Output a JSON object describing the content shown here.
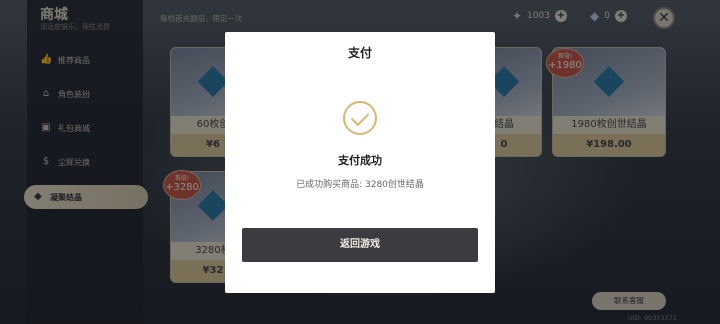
{
  "shop": {
    "title": "商城",
    "subtitle": "请适度娱乐，理性消费"
  },
  "header": {
    "hint": "每档首充翻倍，限定一次",
    "currencies": [
      {
        "icon": "star-crystal-icon",
        "value": "1003"
      },
      {
        "icon": "genesis-crystal-icon",
        "value": "0"
      }
    ]
  },
  "sidebar": {
    "items": [
      {
        "label": "推荐商品",
        "icon": "thumbs-up-icon"
      },
      {
        "label": "角色装扮",
        "icon": "hanger-icon"
      },
      {
        "label": "礼包商城",
        "icon": "gift-icon"
      },
      {
        "label": "尘辉兑换",
        "icon": "money-bag-icon"
      },
      {
        "label": "凝聚结晶",
        "icon": "crystal-icon",
        "active": true
      }
    ]
  },
  "cards": [
    {
      "name": "60枚创",
      "price": "¥6"
    },
    {
      "name": "结晶",
      "price": "0"
    },
    {
      "name": "1980枚创世结晶",
      "price": "¥198.00",
      "badge_label": "首倍!",
      "badge_value": "+1980"
    },
    {
      "name": "3280枚",
      "price": "¥32",
      "badge_label": "首倍!",
      "badge_value": "+3280"
    }
  ],
  "modal": {
    "title": "支付",
    "success_title": "支付成功",
    "success_desc": "已成功购买商品: 3280创世结晶",
    "button": "返回游戏"
  },
  "footer": {
    "support": "联系客服",
    "uid": "UID: 90353271"
  },
  "colors": {
    "accent_gold": "#d4b970",
    "button_dark": "#3d3b40"
  }
}
